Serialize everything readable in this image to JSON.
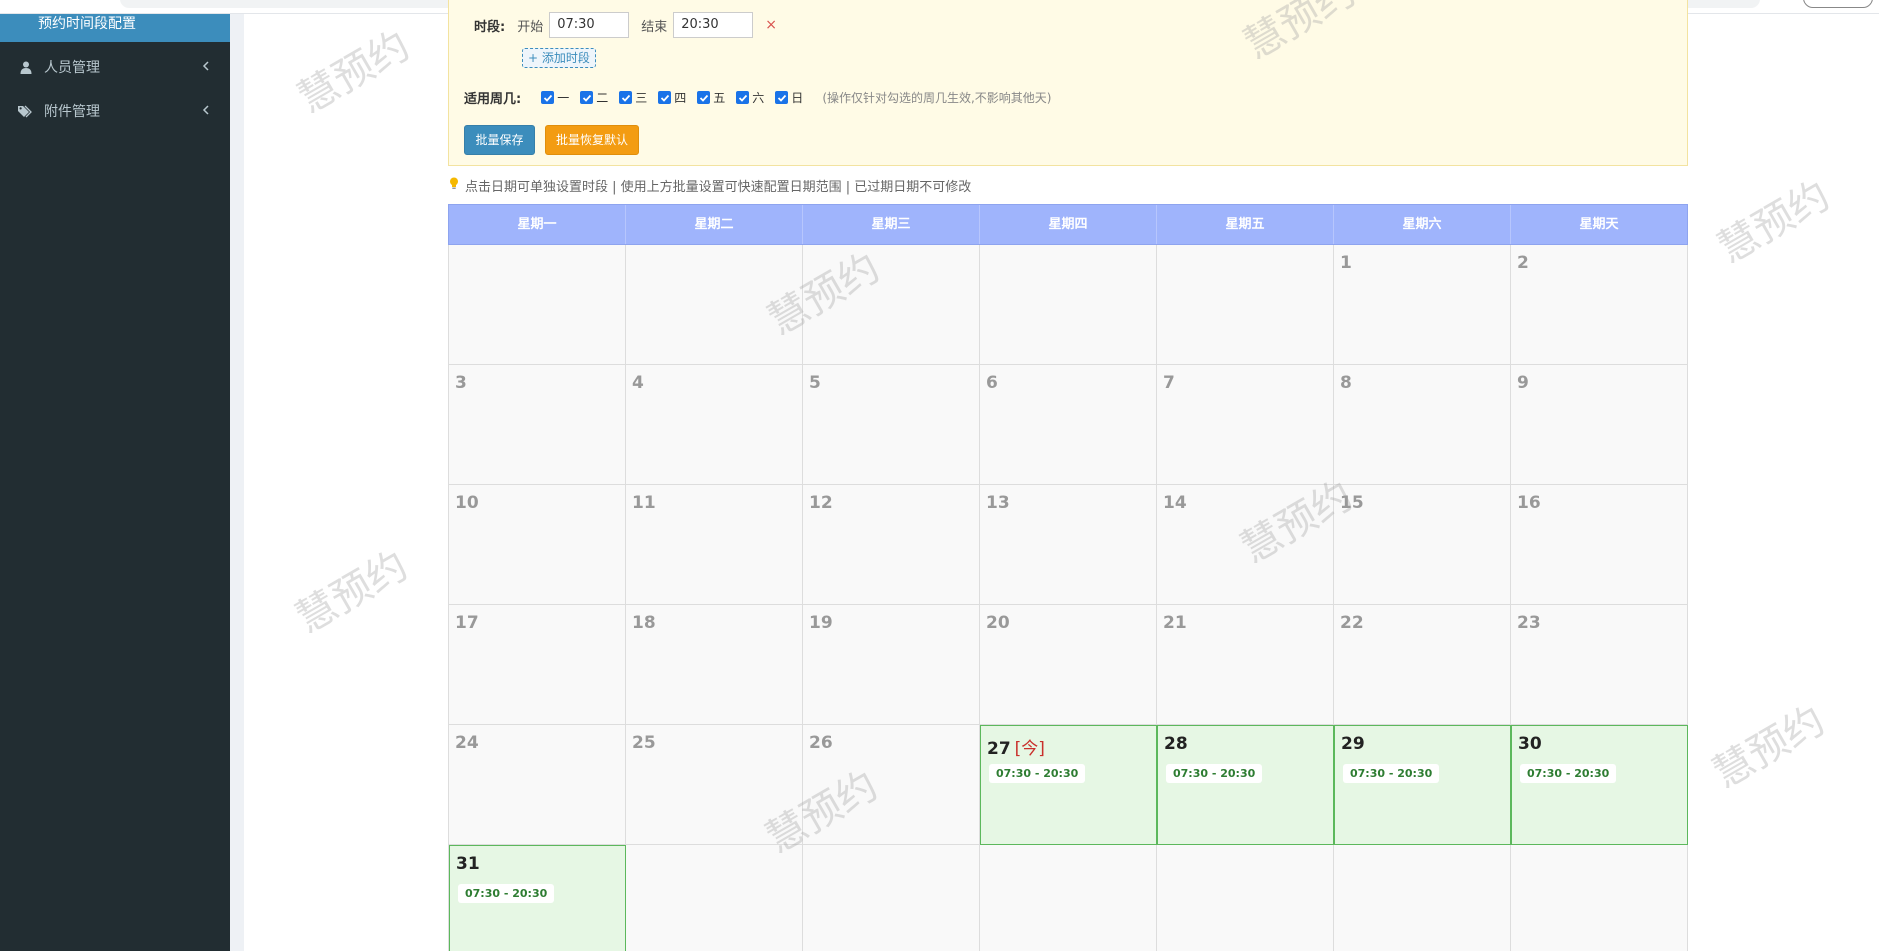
{
  "sidebar": {
    "active_item": "预约时间段配置",
    "items": [
      {
        "label": "人员管理",
        "icon": "user-icon"
      },
      {
        "label": "附件管理",
        "icon": "tags-icon"
      }
    ]
  },
  "batch_panel": {
    "period_label": "时段:",
    "start_label": "开始",
    "start_value": "07:30",
    "end_label": "结束",
    "end_value": "20:30",
    "remove_symbol": "×",
    "add_period_label": "+ 添加时段",
    "weekday_label": "适用周几:",
    "weekdays": [
      "一",
      "二",
      "三",
      "四",
      "五",
      "六",
      "日"
    ],
    "weekday_hint": "(操作仅针对勾选的周几生效,不影响其他天)",
    "save_button": "批量保存",
    "reset_button": "批量恢复默认"
  },
  "tip": {
    "icon": "lightbulb-icon",
    "text": "点击日期可单独设置时段 | 使用上方批量设置可快速配置日期范围 | 已过期日期不可修改"
  },
  "calendar": {
    "headers": [
      "星期一",
      "星期二",
      "星期三",
      "星期四",
      "星期五",
      "星期六",
      "星期天"
    ],
    "today_marker": "[今]",
    "rows": [
      [
        {
          "day": ""
        },
        {
          "day": ""
        },
        {
          "day": ""
        },
        {
          "day": ""
        },
        {
          "day": ""
        },
        {
          "day": "1"
        },
        {
          "day": "2"
        }
      ],
      [
        {
          "day": "3"
        },
        {
          "day": "4"
        },
        {
          "day": "5"
        },
        {
          "day": "6"
        },
        {
          "day": "7"
        },
        {
          "day": "8"
        },
        {
          "day": "9"
        }
      ],
      [
        {
          "day": "10"
        },
        {
          "day": "11"
        },
        {
          "day": "12"
        },
        {
          "day": "13"
        },
        {
          "day": "14"
        },
        {
          "day": "15"
        },
        {
          "day": "16"
        }
      ],
      [
        {
          "day": "17"
        },
        {
          "day": "18"
        },
        {
          "day": "19"
        },
        {
          "day": "20"
        },
        {
          "day": "21"
        },
        {
          "day": "22"
        },
        {
          "day": "23"
        }
      ],
      [
        {
          "day": "24"
        },
        {
          "day": "25"
        },
        {
          "day": "26"
        },
        {
          "day": "27",
          "today": true,
          "slot": "07:30 - 20:30"
        },
        {
          "day": "28",
          "slot": "07:30 - 20:30"
        },
        {
          "day": "29",
          "slot": "07:30 - 20:30"
        },
        {
          "day": "30",
          "slot": "07:30 - 20:30"
        }
      ],
      [
        {
          "day": "31",
          "slot": "07:30 - 20:30"
        },
        {
          "day": ""
        },
        {
          "day": ""
        },
        {
          "day": ""
        },
        {
          "day": ""
        },
        {
          "day": ""
        },
        {
          "day": ""
        }
      ]
    ]
  },
  "watermark": "慧预约",
  "colors": {
    "sidebar_bg": "#222d32",
    "active_item_bg": "#3c8dbc",
    "calendar_header_bg": "#9fb4fc",
    "available_day_bg": "#e6f7e4",
    "available_day_border": "#5cb85c",
    "save_button_bg": "#3c8dbc",
    "reset_button_bg": "#f39c12",
    "today_marker": "#c9302c"
  }
}
